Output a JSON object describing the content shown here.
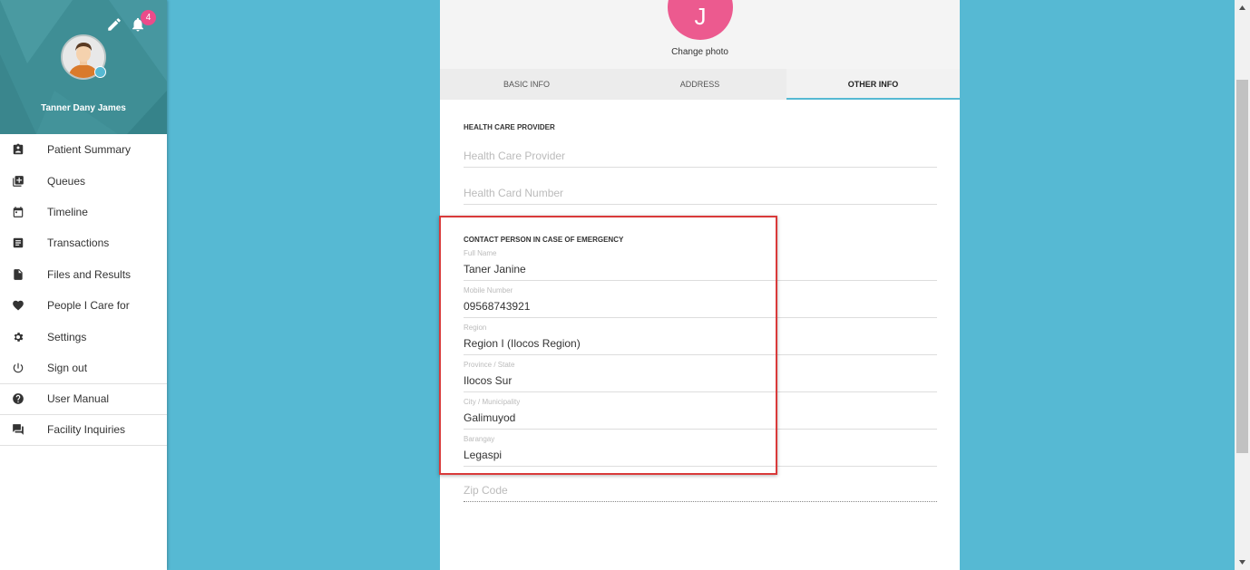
{
  "profile": {
    "name": "Tanner Dany James",
    "notification_count": "4"
  },
  "menu": [
    {
      "label": "Patient Summary",
      "icon": "clipboard-user-icon"
    },
    {
      "label": "Queues",
      "icon": "queue-add-icon"
    },
    {
      "label": "Timeline",
      "icon": "calendar-icon"
    },
    {
      "label": "Transactions",
      "icon": "list-icon"
    },
    {
      "label": "Files and Results",
      "icon": "file-icon"
    },
    {
      "label": "People I Care for",
      "icon": "heart-icon"
    },
    {
      "label": "Settings",
      "icon": "gear-icon"
    },
    {
      "label": "Sign out",
      "icon": "power-icon"
    },
    {
      "label": "User Manual",
      "icon": "help-icon"
    },
    {
      "label": "Facility Inquiries",
      "icon": "chat-icon"
    }
  ],
  "photo": {
    "initial": "J",
    "change_label": "Change photo"
  },
  "tabs": [
    {
      "label": "BASIC INFO",
      "active": false
    },
    {
      "label": "ADDRESS",
      "active": false
    },
    {
      "label": "OTHER INFO",
      "active": true
    }
  ],
  "health": {
    "title": "HEALTH CARE PROVIDER",
    "provider_placeholder": "Health Care Provider",
    "card_placeholder": "Health Card Number"
  },
  "emergency": {
    "title": "CONTACT PERSON IN CASE OF EMERGENCY",
    "fields": [
      {
        "label": "Full Name",
        "value": "Taner Janine"
      },
      {
        "label": "Mobile Number",
        "value": "09568743921"
      },
      {
        "label": "Region",
        "value": "Region I (Ilocos Region)"
      },
      {
        "label": "Province / State",
        "value": "Ilocos Sur"
      },
      {
        "label": "City / Municipality",
        "value": "Galimuyod"
      },
      {
        "label": "Barangay",
        "value": "Legaspi"
      }
    ],
    "zip_placeholder": "Zip Code"
  },
  "colors": {
    "accent": "#56b9d3",
    "header": "#3f8e95",
    "photo": "#ec5a8f",
    "badge": "#ec4c8a",
    "highlight": "#d93a3a"
  }
}
